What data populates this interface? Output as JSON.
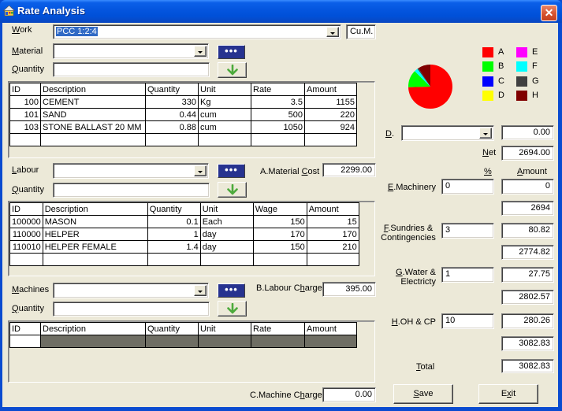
{
  "window": {
    "title": "Rate Analysis",
    "close_label": "✕"
  },
  "work": {
    "label": "Work",
    "accel": 0,
    "value": "PCC 1:2:4",
    "unit": "Cu.M."
  },
  "material": {
    "label": "Material",
    "accel": 0,
    "value": "",
    "browse_label": "•••",
    "quantity_label": "Quantity",
    "quantity_accel": 0,
    "quantity_value": "",
    "columns": [
      "ID",
      "Description",
      "Quantity",
      "Unit",
      "Rate",
      "Amount"
    ],
    "rows": [
      [
        "100",
        "CEMENT",
        "330",
        "Kg",
        "3.5",
        "1155"
      ],
      [
        "101",
        "SAND",
        "0.44",
        "cum",
        "500",
        "220"
      ],
      [
        "103",
        "STONE BALLAST 20 MM",
        "0.88",
        "cum",
        "1050",
        "924"
      ]
    ],
    "cost_label": "A.Material Cost",
    "cost_accel": 11,
    "cost_value": "2299.00"
  },
  "labour": {
    "label": "Labour",
    "accel": 0,
    "value": "",
    "browse_label": "•••",
    "quantity_label": "Quantity",
    "quantity_accel": 0,
    "quantity_value": "",
    "columns": [
      "ID",
      "Description",
      "Quantity",
      "Unit",
      "Wage",
      "Amount"
    ],
    "rows": [
      [
        "100000",
        "MASON",
        "0.1",
        "Each",
        "150",
        "15"
      ],
      [
        "110000",
        "HELPER",
        "1",
        "day",
        "170",
        "170"
      ],
      [
        "110010",
        "HELPER FEMALE",
        "1.4",
        "day",
        "150",
        "210"
      ]
    ],
    "charge_label": "B.Labour Charge",
    "charge_accel": 10,
    "charge_value": "395.00"
  },
  "machines": {
    "label": "Machines",
    "accel": 0,
    "value": "",
    "browse_label": "•••",
    "quantity_label": "Quantity",
    "quantity_accel": 0,
    "quantity_value": "",
    "columns": [
      "ID",
      "Description",
      "Quantity",
      "Unit",
      "Rate",
      "Amount"
    ],
    "rows": [],
    "charge_label": "C.Machine Charge",
    "charge_accel": 11,
    "charge_value": "0.00"
  },
  "summary": {
    "d": {
      "label": "D.",
      "accel": 0,
      "select_value": "",
      "amount": "0.00"
    },
    "net": {
      "label": "Net",
      "accel": 0,
      "value": "2694.00"
    },
    "pct_header": "%",
    "amount_header": "Amount",
    "rows": [
      {
        "line1": "E.Machinery",
        "line2": "",
        "accel": 0,
        "pct": "0",
        "amount": "0",
        "subtotal": "2694"
      },
      {
        "line1": "F.Sundries &",
        "line2": "Contingencies",
        "accel": 0,
        "pct": "3",
        "amount": "80.82",
        "subtotal": "2774.82"
      },
      {
        "line1": "G.Water &",
        "line2": "Electricty",
        "accel": 0,
        "pct": "1",
        "amount": "27.75",
        "subtotal": "2802.57"
      },
      {
        "line1": "H.OH & CP",
        "line2": "",
        "accel": 0,
        "pct": "10",
        "amount": "280.26",
        "subtotal": "3082.83"
      }
    ],
    "total": {
      "label": "Total",
      "accel": 0,
      "value": "3082.83"
    }
  },
  "buttons": {
    "save": {
      "label": "Save",
      "accel": 0
    },
    "exit": {
      "label": "Exit",
      "accel": 1
    }
  },
  "chart_data": {
    "type": "pie",
    "title": "",
    "categories": [
      "A",
      "B",
      "C",
      "D",
      "E",
      "F",
      "G",
      "H"
    ],
    "values": [
      2299.0,
      395.0,
      0,
      0,
      0,
      80.82,
      27.75,
      280.26
    ],
    "colors": [
      "#ff0000",
      "#00ff00",
      "#0000ff",
      "#ffff00",
      "#ff00ff",
      "#00ffff",
      "#404040",
      "#800000"
    ],
    "start_angle": "12 o'clock",
    "direction": "clockwise",
    "legend_position": "top-right"
  }
}
